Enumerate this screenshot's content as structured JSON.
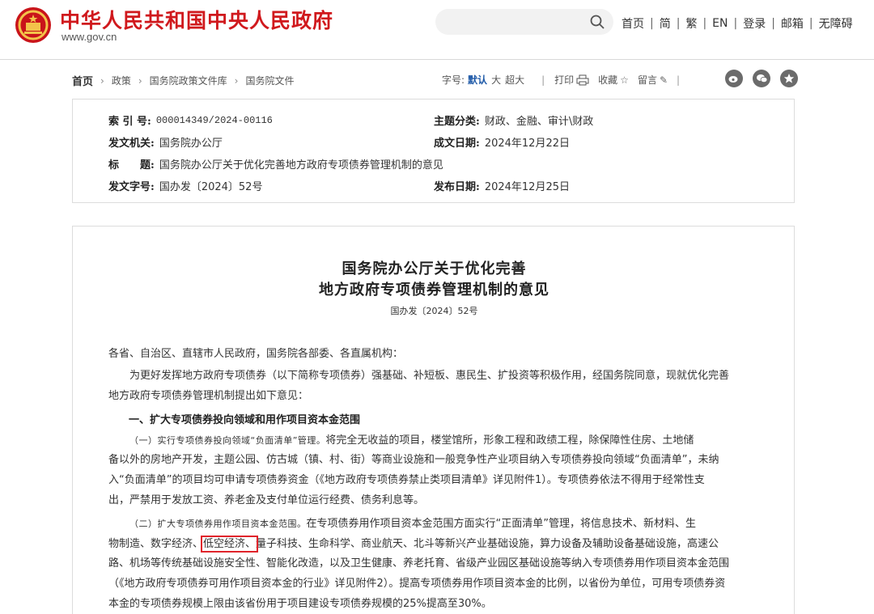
{
  "header": {
    "site_title": "中华人民共和国中央人民政府",
    "site_url": "www.gov.cn",
    "nav": [
      "首页",
      "简",
      "繁",
      "EN",
      "登录",
      "邮箱",
      "无障碍"
    ]
  },
  "breadcrumb": {
    "items": [
      "首页",
      "政策",
      "国务院政策文件库",
      "国务院文件"
    ]
  },
  "toolbar": {
    "font_size_label": "字号:",
    "font_sizes": [
      "默认",
      "大",
      "超大"
    ],
    "print": "打印",
    "favorite": "收藏",
    "comment": "留言"
  },
  "share_icons": [
    "weibo-icon",
    "wechat-icon",
    "qzone-icon"
  ],
  "info": {
    "index_label": "索 引 号:",
    "index_value": "000014349/2024-00116",
    "category_label": "主题分类:",
    "category_value": "财政、金融、审计\\财政",
    "issuer_label": "发文机关:",
    "issuer_value": "国务院办公厅",
    "created_label": "成文日期:",
    "created_value": "2024年12月22日",
    "title_label": "标　　题:",
    "title_value": "国务院办公厅关于优化完善地方政府专项债券管理机制的意见",
    "docno_label": "发文字号:",
    "docno_value": "国办发〔2024〕52号",
    "published_label": "发布日期:",
    "published_value": "2024年12月25日"
  },
  "article": {
    "title_line1": "国务院办公厅关于优化完善",
    "title_line2": "地方政府专项债券管理机制的意见",
    "doc_number": "国办发〔2024〕52号",
    "salutation": "各省、自治区、直辖市人民政府，国务院各部委、各直属机构：",
    "intro_line1": "为更好发挥地方政府专项债券（以下简称专项债券）强基础、补短板、惠民生、扩投资等积极作用，经国务院同意，现就优化完善",
    "intro_line2": "地方政府专项债券管理机制提出如下意见：",
    "section1": "一、扩大专项债券投向领域和用作项目资本金范围",
    "p1_head": "（一）实行专项债券投向领域“负面清单”管理。",
    "p1_line1_rest": "将完全无收益的项目，楼堂馆所，形象工程和政绩工程，除保障性住房、土地储",
    "p1_line2": "备以外的房地产开发，主题公园、仿古城（镇、村、街）等商业设施和一般竞争性产业项目纳入专项债券投向领域“负面清单”，未纳",
    "p1_line3": "入“负面清单”的项目均可申请专项债券资金（《地方政府专项债券禁止类项目清单》详见附件1）。专项债券依法不得用于经常性支",
    "p1_line4": "出，严禁用于发放工资、养老金及支付单位运行经费、债务利息等。",
    "p2_head": "（二）扩大专项债券用作项目资本金范围。",
    "p2_line1_rest": "在专项债券用作项目资本金范围方面实行“正面清单”管理，将信息技术、新材料、生",
    "p2_line2_a": "物制造、数字经济、",
    "p2_line2_hl": "低空经济、",
    "p2_line2_b": "量子科技、生命科学、商业航天、北斗等新兴产业基础设施，算力设备及辅助设备基础设施，高速公",
    "p2_line3": "路、机场等传统基础设施安全性、智能化改造，以及卫生健康、养老托育、省级产业园区基础设施等纳入专项债券用作项目资本金范围",
    "p2_line4": "（《地方政府专项债券可用作项目资本金的行业》详见附件2）。提高专项债券用作项目资本金的比例，以省份为单位，可用专项债券资",
    "p2_line5": "本金的专项债券规模上限由该省份用于项目建设专项债券规模的25%提高至30%。"
  }
}
